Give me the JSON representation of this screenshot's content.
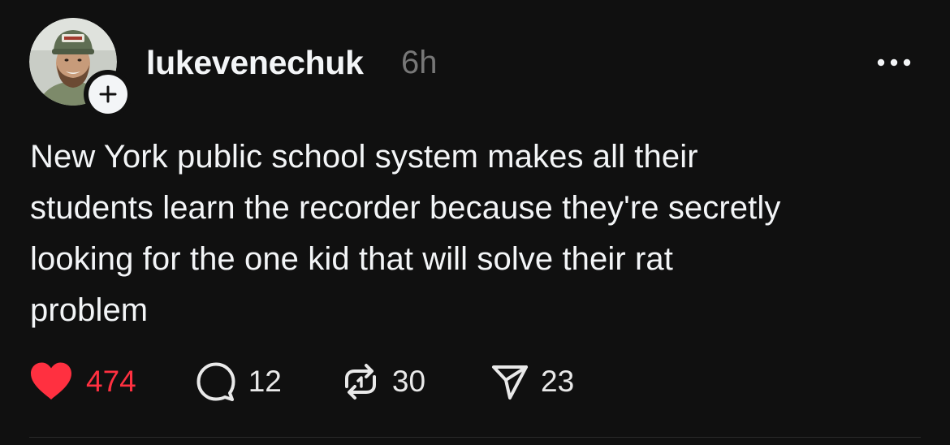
{
  "post": {
    "author": {
      "username": "lukevenechuk",
      "time": "6h",
      "avatar_icon": "profile-photo",
      "follow_icon": "plus-icon"
    },
    "text_lines": [
      "New York public school system makes all their",
      "students learn the recorder because they're secretly",
      "looking for the one kid that will solve their rat",
      "problem"
    ],
    "actions": {
      "likes": "474",
      "replies": "12",
      "reposts": "30",
      "shares": "23"
    },
    "colors": {
      "background": "#101010",
      "text": "#f3f5f7",
      "muted": "#777777",
      "like_red": "#ff3040"
    }
  }
}
